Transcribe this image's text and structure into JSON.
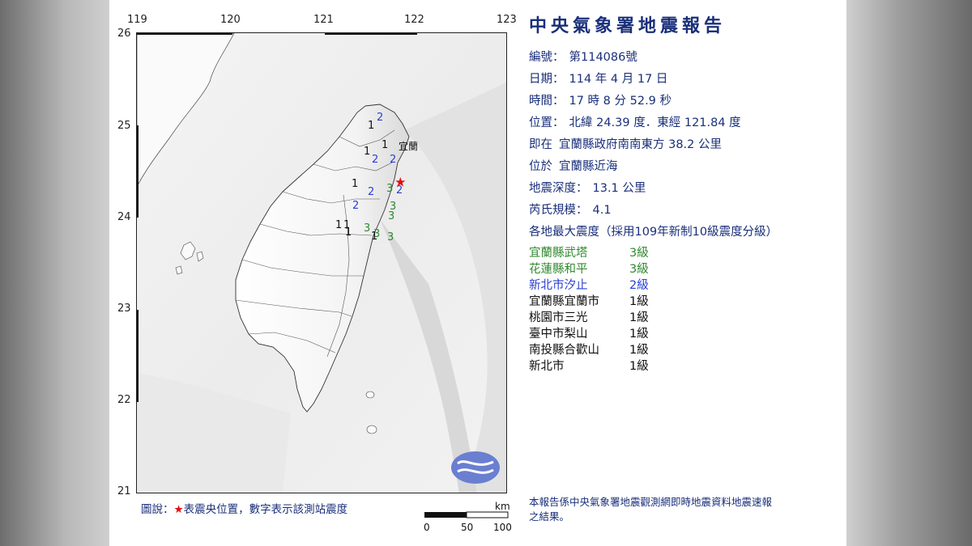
{
  "report": {
    "title": "中央氣象署地震報告",
    "number_label": "編號：",
    "number": "第114086號",
    "date_label": "日期：",
    "date": "114 年 4 月 17 日",
    "time_label": "時間：",
    "time": "17 時 8 分 52.9 秒",
    "position_label": "位置：",
    "position": "北緯 24.39 度．東經 121.84 度",
    "located_label": "即在",
    "located": "宜蘭縣政府南南東方 38.2 公里",
    "area_label": "位於",
    "area": "宜蘭縣近海",
    "depth_label": "地震深度：",
    "depth": "13.1 公里",
    "magnitude_label": "芮氏規模：",
    "magnitude": "4.1",
    "intensity_heading": "各地最大震度（採用109年新制10級震度分級）",
    "intensities": [
      {
        "place": "宜蘭縣武塔",
        "level": "3級",
        "color": "#2f8a2f"
      },
      {
        "place": "花蓮縣和平",
        "level": "3級",
        "color": "#2f8a2f"
      },
      {
        "place": "新北市汐止",
        "level": "2級",
        "color": "#2a3fd6"
      },
      {
        "place": "宜蘭縣宜蘭市",
        "level": "1級",
        "color": "#111111"
      },
      {
        "place": "桃園市三光",
        "level": "1級",
        "color": "#111111"
      },
      {
        "place": "臺中市梨山",
        "level": "1級",
        "color": "#111111"
      },
      {
        "place": "南投縣合歡山",
        "level": "1級",
        "color": "#111111"
      },
      {
        "place": "新北市",
        "level": "1級",
        "color": "#111111"
      }
    ],
    "note": "本報告係中央氣象署地震觀測網即時地震資料地震速報之結果。"
  },
  "map": {
    "lon_ticks": [
      "119",
      "120",
      "121",
      "122",
      "123"
    ],
    "lat_ticks": [
      "26",
      "25",
      "24",
      "23",
      "22",
      "21"
    ],
    "city_label": "宜蘭",
    "epicenter": {
      "lon": 121.84,
      "lat": 24.39
    },
    "station_marks": [
      {
        "text": "2",
        "color": "#2a3fd6"
      },
      {
        "text": "1",
        "color": "#111111"
      },
      {
        "text": "1",
        "color": "#111111"
      },
      {
        "text": "1",
        "color": "#111111"
      },
      {
        "text": "1",
        "color": "#111111"
      },
      {
        "text": "2",
        "color": "#2a3fd6"
      },
      {
        "text": "2",
        "color": "#2a3fd6"
      },
      {
        "text": "2",
        "color": "#2a3fd6"
      },
      {
        "text": "3",
        "color": "#2f8a2f"
      },
      {
        "text": "2",
        "color": "#2a3fd6"
      },
      {
        "text": "2",
        "color": "#2a3fd6"
      },
      {
        "text": "3",
        "color": "#2f8a2f"
      },
      {
        "text": "3",
        "color": "#2f8a2f"
      },
      {
        "text": "3",
        "color": "#2f8a2f"
      },
      {
        "text": "1",
        "color": "#111111"
      },
      {
        "text": "1",
        "color": "#111111"
      },
      {
        "text": "1",
        "color": "#111111"
      },
      {
        "text": "3",
        "color": "#2f8a2f"
      },
      {
        "text": "3",
        "color": "#2f8a2f"
      },
      {
        "text": "1",
        "color": "#111111"
      }
    ]
  },
  "legend": {
    "prefix": "圖說：",
    "star": "★",
    "text": "表震央位置，數字表示該測站震度"
  },
  "scale_bar": {
    "unit": "km",
    "labels": [
      "0",
      "50",
      "100"
    ]
  }
}
